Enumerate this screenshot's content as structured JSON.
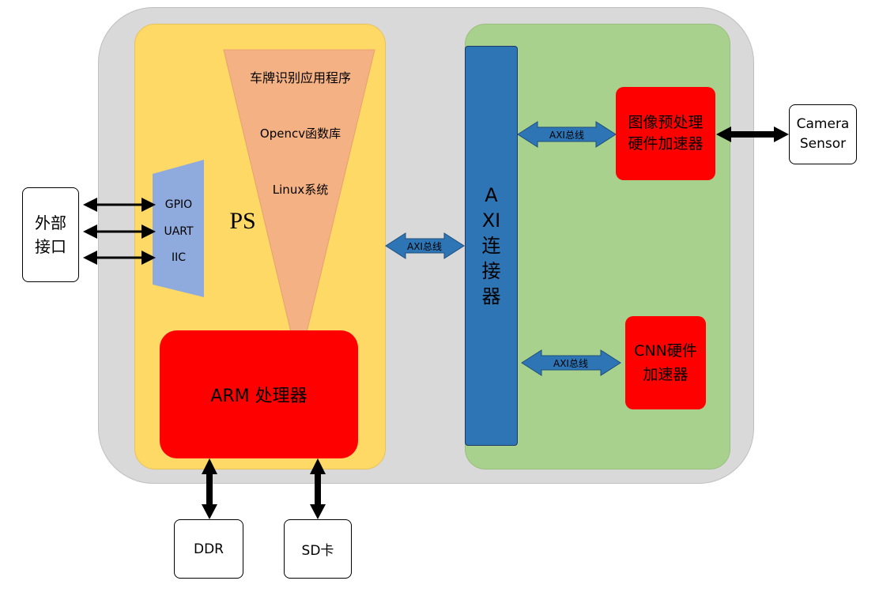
{
  "ps": {
    "label": "PS",
    "stack": [
      "车牌识别应用程序",
      "Opencv函数库",
      "Linux系统"
    ],
    "io": [
      "GPIO",
      "UART",
      "IIC"
    ],
    "arm_label": "ARM 处理器"
  },
  "axi": {
    "connector_label": "AXI连接器",
    "bus_label": "AXI总线"
  },
  "pl": {
    "isp_label": "图像预处理硬件加速器",
    "cnn_label": "CNN硬件加速器"
  },
  "external": {
    "interface_label": "外部接口",
    "camera_label": "Camera Sensor",
    "ddr_label": "DDR",
    "sd_label": "SD卡"
  },
  "colors": {
    "outer": "#d9d9d9",
    "ps": "#ffd966",
    "pl": "#a9d18e",
    "axi_blue": "#2e75b6",
    "accelerator_red": "#ff0000",
    "software_stack": "#f4b183",
    "io_block": "#8faadc"
  }
}
